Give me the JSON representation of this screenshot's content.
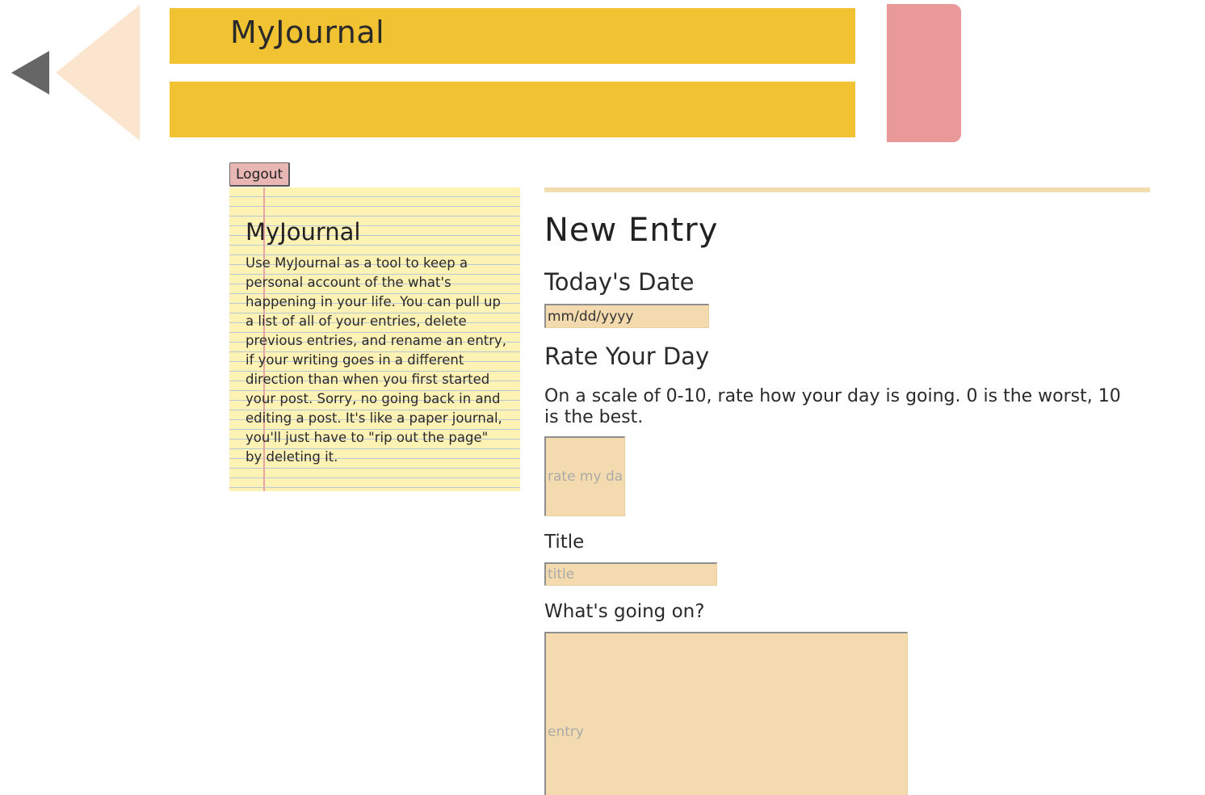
{
  "header": {
    "title": "MyJournal"
  },
  "account": {
    "logout_label": "Logout"
  },
  "sidebar": {
    "title": "MyJournal",
    "description": "Use MyJournal as a tool to keep a personal account of the what's happening in your life. You can pull up a list of all of your entries, delete previous entries, and rename an entry, if your writing goes in a different direction than when you first started your post. Sorry, no going back in and editing a post. It's like a paper journal, you'll just have to \"rip out the page\" by deleting it."
  },
  "form": {
    "heading": "New Entry",
    "date": {
      "label": "Today's Date",
      "placeholder": "mm/dd/yyyy"
    },
    "rating": {
      "label": "Rate Your Day",
      "instructions": "On a scale of 0-10, rate how your day is going. 0 is the worst, 10 is the best.",
      "placeholder": "rate my day"
    },
    "title": {
      "label": "Title",
      "placeholder": "title"
    },
    "entry": {
      "label": "What's going on?",
      "placeholder": "entry"
    }
  },
  "colors": {
    "pencil_body": "#f1c232",
    "pencil_wood": "#fce5cf",
    "pencil_tip": "#666666",
    "eraser": "#ea9999",
    "notepad": "#fff2b5",
    "input_background": "#f4dbaf",
    "logout_button": "#e8b7b4"
  }
}
